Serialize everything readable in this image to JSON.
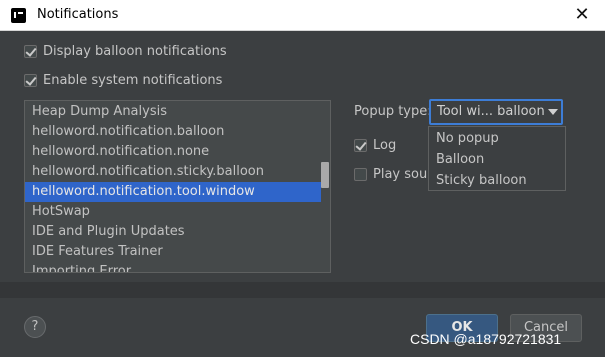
{
  "window": {
    "title": "Notifications"
  },
  "checkboxes": {
    "balloon": {
      "label": "Display balloon notifications",
      "checked": true
    },
    "system": {
      "label": "Enable system notifications",
      "checked": true
    }
  },
  "list": {
    "items": [
      "Heap Dump Analysis",
      "helloword.notification.balloon",
      "helloword.notification.none",
      "helloword.notification.sticky.balloon",
      "helloword.notification.tool.window",
      "HotSwap",
      "IDE and Plugin Updates",
      "IDE Features Trainer",
      "Importing Error"
    ],
    "selected": "helloword.notification.tool.window"
  },
  "popup": {
    "label": "Popup type:",
    "value": "Tool wi... balloon",
    "options": [
      "No popup",
      "Balloon",
      "Sticky balloon"
    ]
  },
  "options": {
    "log": {
      "label": "Log",
      "checked": true
    },
    "play_sound": {
      "label": "Play sour",
      "checked": false
    }
  },
  "buttons": {
    "help": "?",
    "ok": "OK",
    "cancel": "Cancel"
  },
  "watermark": "CSDN @a18792721831",
  "colors": {
    "selection": "#2f65ca",
    "focus": "#3d7dd6",
    "ok_button": "#365880"
  }
}
